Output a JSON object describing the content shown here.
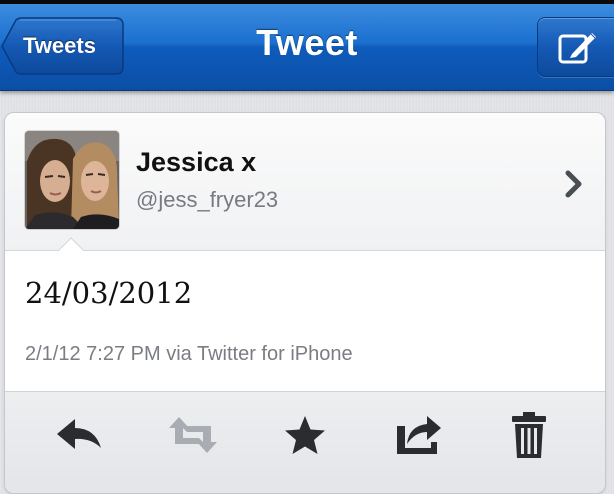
{
  "nav": {
    "title": "Tweet",
    "back_label": "Tweets"
  },
  "tweet": {
    "author_name": "Jessica x",
    "author_handle": "@jess_fryer23",
    "text": "24/03/2012",
    "meta": "2/1/12 7:27 PM via Twitter for iPhone"
  },
  "icons": {
    "compose": "compose-icon",
    "chevron": "chevron-right-icon",
    "reply": "reply-icon",
    "retweet": "retweet-icon",
    "favorite": "star-icon",
    "share": "share-icon",
    "delete": "trash-icon"
  },
  "colors": {
    "nav_blue": "#1b6fcf",
    "retweet_disabled": "#a9adb3",
    "icon_dark": "#2a2c30"
  }
}
